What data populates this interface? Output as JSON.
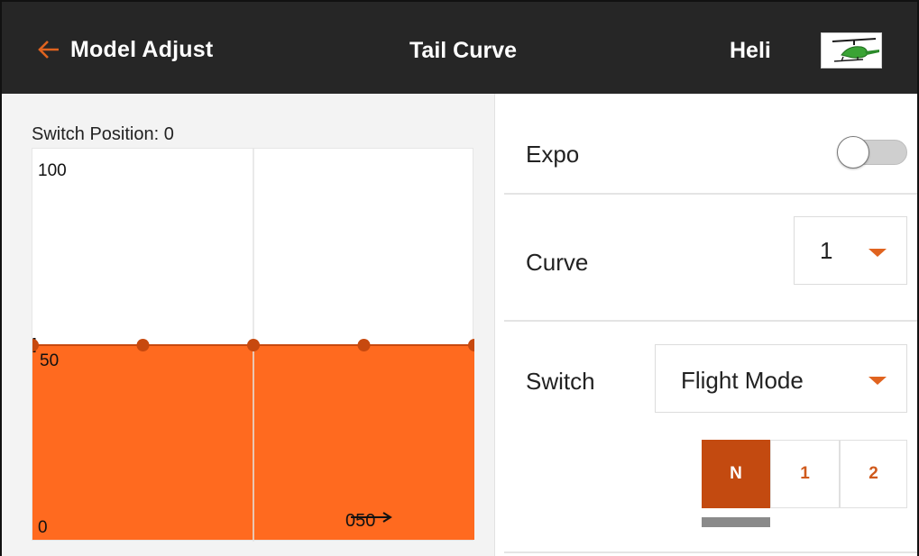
{
  "header": {
    "back_label": "Model Adjust",
    "title": "Tail Curve",
    "model_name": "Heli",
    "model_image_icon": "helicopter-icon"
  },
  "curve": {
    "switch_position_text": "Switch Position: 0",
    "y_axis_labels": {
      "max": "100",
      "mid": "50",
      "min": "0"
    },
    "io_input": "0",
    "io_output": "50",
    "points": [
      50,
      50,
      50,
      50,
      50
    ],
    "fill_color": "#ff6a1f",
    "point_color": "#c7490f"
  },
  "settings": {
    "expo_label": "Expo",
    "expo_enabled": false,
    "curve_label": "Curve",
    "curve_value": "1",
    "switch_label": "Switch",
    "switch_value": "Flight Mode",
    "positions": [
      "N",
      "1",
      "2"
    ],
    "active_position": "N"
  },
  "colors": {
    "header_bg": "#262626",
    "accent": "#e0631f",
    "active_segment": "#c34a10"
  }
}
